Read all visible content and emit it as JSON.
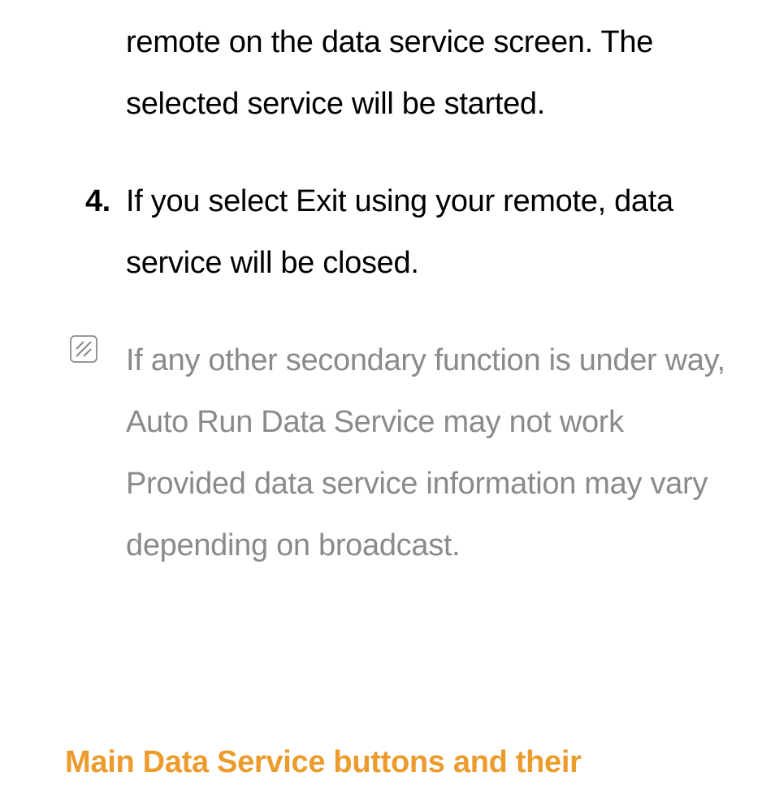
{
  "para1": "remote on the data service screen. The selected service will be started.",
  "item4": {
    "num": "4.",
    "text": "If you select Exit using your remote, data service will be closed."
  },
  "note": "If any other secondary function is under way, Auto Run Data Service may not work Provided data service information may vary depending on broadcast.",
  "heading": "Main Data Service buttons and their"
}
